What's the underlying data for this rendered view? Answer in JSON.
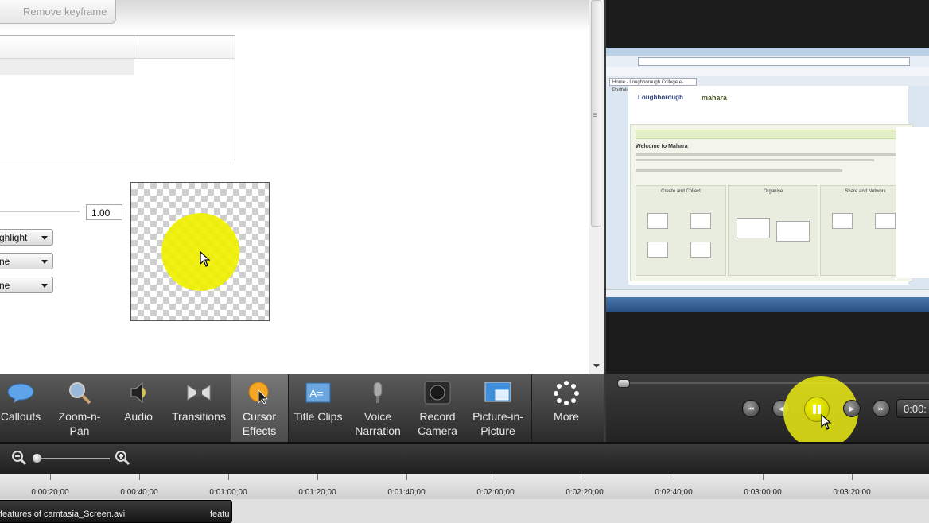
{
  "properties": {
    "remove_keyframe_label": "Remove keyframe",
    "opacity_value": "1.00",
    "dropdowns": [
      "ghlight",
      "ne",
      "ne"
    ]
  },
  "preview_screenshot": {
    "tab_title": "Home - Loughborough College e-Portfolio",
    "logo_left": "Loughborough",
    "logo_right": "mahara",
    "welcome": "Welcome to Mahara",
    "columns": [
      "Create and Collect",
      "Organise",
      "Share and Network"
    ]
  },
  "tasks": [
    {
      "label": "Callouts",
      "icon": "callout-icon"
    },
    {
      "label": "Zoom-n-Pan",
      "icon": "zoom-icon"
    },
    {
      "label": "Audio",
      "icon": "speaker-icon"
    },
    {
      "label": "Transitions",
      "icon": "transitions-icon"
    },
    {
      "label": "Cursor Effects",
      "icon": "cursor-effects-icon"
    },
    {
      "label": "Title Clips",
      "icon": "title-clips-icon"
    },
    {
      "label": "Voice Narration",
      "icon": "microphone-icon"
    },
    {
      "label": "Record Camera",
      "icon": "camera-icon"
    },
    {
      "label": "Picture-in-Picture",
      "icon": "picture-in-picture-icon"
    },
    {
      "label": "More",
      "icon": "more-icon"
    }
  ],
  "player": {
    "time": "0:00:"
  },
  "timeline": {
    "ruler_labels": [
      "0:00:20;00",
      "0:00:40;00",
      "0:01:00;00",
      "0:01:20;00",
      "0:01:40;00",
      "0:02:00;00",
      "0:02:20;00",
      "0:02:40;00",
      "0:03:00;00",
      "0:03:20;00"
    ],
    "clip_name": "features of camtasia_Screen.avi",
    "clip_name_2": "featu"
  }
}
